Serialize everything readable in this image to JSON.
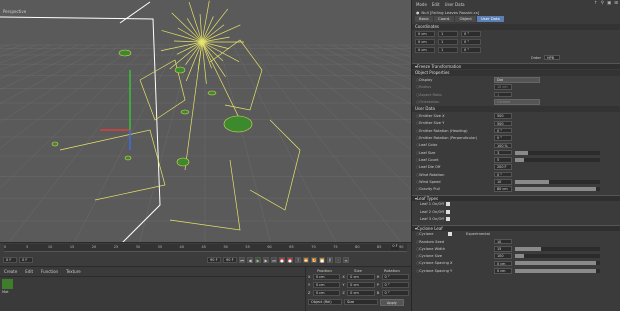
{
  "viewport": {
    "label": "Perspective"
  },
  "timeline": {
    "ticks": [
      "0",
      "5",
      "10",
      "15",
      "20",
      "25",
      "30",
      "35",
      "40",
      "45",
      "50",
      "55",
      "60",
      "65",
      "70",
      "75",
      "80",
      "85",
      "90"
    ],
    "frame_marker": "0 F",
    "start": "0 F",
    "current": "0 F",
    "end": "90 F",
    "end2": "90 F"
  },
  "materials": {
    "menu": [
      "Create",
      "Edit",
      "Function",
      "Texture"
    ],
    "swatch_color": "#3f7d2a",
    "swatch_name": "Mat"
  },
  "coordinates": {
    "headers": [
      "Position",
      "Size",
      "Rotation"
    ],
    "rows": [
      {
        "axis": "X",
        "pos": "0 cm",
        "size": "0 cm",
        "rotlabel": "H",
        "rot": "0 °"
      },
      {
        "axis": "Y",
        "pos": "0 cm",
        "size": "0 cm",
        "rotlabel": "P",
        "rot": "0 °"
      },
      {
        "axis": "Z",
        "pos": "0 cm",
        "size": "0 cm",
        "rotlabel": "B",
        "rot": "0 °"
      }
    ],
    "mode1": "Object (Rel)",
    "mode2": "Size",
    "apply": "Apply"
  },
  "attributes": {
    "menu": [
      "Mode",
      "Edit",
      "User Data"
    ],
    "title": "Null [Falling Leaves Rossini.cs]",
    "tabs": [
      "Basic",
      "Coord.",
      "Object",
      "User Data"
    ],
    "active_tab": "User Data",
    "coordinates_header": "Coordinates",
    "coord_rows": [
      {
        "p": "0 cm",
        "s": "1",
        "r": "0 °"
      },
      {
        "p": "0 cm",
        "s": "1",
        "r": "0 °"
      },
      {
        "p": "0 cm",
        "s": "1",
        "r": "0 °"
      }
    ],
    "order_label": "Order",
    "order_value": "HPB",
    "freeze_band": "Freeze Transformation",
    "object_props": "Object Properties",
    "display_label": "Display",
    "display_value": "Dot",
    "radius_label": "Radius",
    "radius_value": "10 cm",
    "aspect_label": "Aspect Ratio",
    "aspect_value": "1",
    "orientation_label": "Orientation",
    "orientation_value": "Camera",
    "user_data": "User Data",
    "user_rows": [
      {
        "label": "Emitter Size X",
        "value": "500",
        "fill": 0
      },
      {
        "label": "Emitter Size Y",
        "value": "500",
        "fill": 0
      },
      {
        "label": "Emitter Rotation (Heading)",
        "value": "0 °",
        "fill": 0
      },
      {
        "label": "Emitter Rotation (Perpendicular)",
        "value": "0 °",
        "fill": 0
      },
      {
        "label": "Leaf Color",
        "value": "100 %",
        "fill": 0
      },
      {
        "label": "Leaf Size",
        "value": "3",
        "fill": 0.15
      },
      {
        "label": "Leaf Count",
        "value": "5",
        "fill": 0.1
      },
      {
        "label": "Leaf Die Off",
        "value": "200 F",
        "fill": 0
      },
      {
        "label": "Wind Rotation",
        "value": "0 °",
        "fill": 0
      },
      {
        "label": "Wind Speed",
        "value": "10",
        "fill": 0.4
      },
      {
        "label": "Gravity Pull",
        "value": "80 cm",
        "fill": 0.95
      }
    ],
    "leaf_types_band": "Leaf Types",
    "leaf_types": [
      {
        "label": "Leaf 1 On/Off"
      },
      {
        "label": "Leaf 2 On/Off"
      },
      {
        "label": "Leaf 3 On/Off"
      }
    ],
    "cyclone_band": "Cyclone Leaf",
    "cyclone_label": "Cyclone",
    "cyclone_note": "Experimental",
    "cyclone_rows": [
      {
        "label": "Random Seed",
        "value": "10",
        "fill": 0
      },
      {
        "label": "Cyclone Width",
        "value": "15",
        "fill": 0.3
      },
      {
        "label": "Cyclone Size",
        "value": "100",
        "fill": 0.1
      },
      {
        "label": "Cyclone Spacing X",
        "value": "0 cm",
        "fill": 0.95
      },
      {
        "label": "Cyclone Spacing Y",
        "value": "0 cm",
        "fill": 0.95
      }
    ]
  }
}
